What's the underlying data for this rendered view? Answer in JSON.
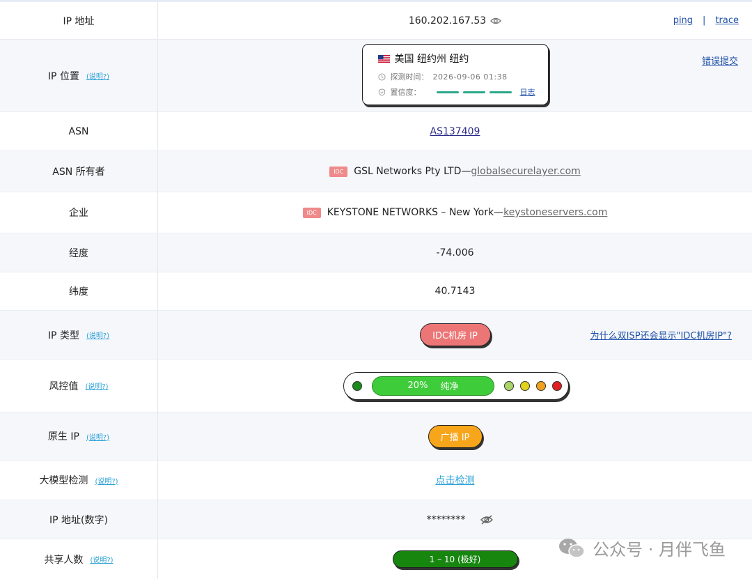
{
  "rows": {
    "ip": {
      "label": "IP 地址",
      "value": "160.202.167.53",
      "ping": "ping",
      "sep": "|",
      "trace": "trace"
    },
    "location": {
      "label": "IP 位置",
      "help": "(说明?)",
      "place": "美国 纽约州 纽约",
      "time_label": "探测时间：",
      "time_value": "2026-09-06 01:38",
      "trust_label": "置信度：",
      "log": "日志",
      "report": "错误提交"
    },
    "asn": {
      "label": "ASN",
      "value": "AS137409"
    },
    "owner": {
      "label": "ASN 所有者",
      "tag": "IDC",
      "name": "GSL Networks Pty LTD—",
      "domain": "globalsecurelayer.com"
    },
    "company": {
      "label": "企业",
      "tag": "IDC",
      "name": "KEYSTONE NETWORKS – New York—",
      "domain": "keystoneservers.com"
    },
    "longitude": {
      "label": "经度",
      "value": "-74.006"
    },
    "latitude": {
      "label": "纬度",
      "value": "40.7143"
    },
    "type": {
      "label": "IP 类型",
      "help": "(说明?)",
      "badge": "IDC机房 IP",
      "link": "为什么双ISP还会显示\"IDC机房IP\"?"
    },
    "risk": {
      "label": "风控值",
      "help": "(说明?)",
      "value_text": "20%",
      "level": "纯净",
      "value": 0.2,
      "colors": [
        "#1d8a1d",
        "#a9d468",
        "#e3d21b",
        "#f2a11d",
        "#e02020"
      ]
    },
    "native": {
      "label": "原生 IP",
      "help": "(说明?)",
      "badge": "广播 IP"
    },
    "llm": {
      "label": "大模型检测",
      "help": "(说明?)",
      "action": "点击检测"
    },
    "numeric": {
      "label": "IP 地址(数字)",
      "value": "********"
    },
    "share": {
      "label": "共享人数",
      "help": "(说明?)",
      "badge": "1 – 10 (极好)"
    }
  },
  "watermark": "公众号 · 月伴飞鱼"
}
